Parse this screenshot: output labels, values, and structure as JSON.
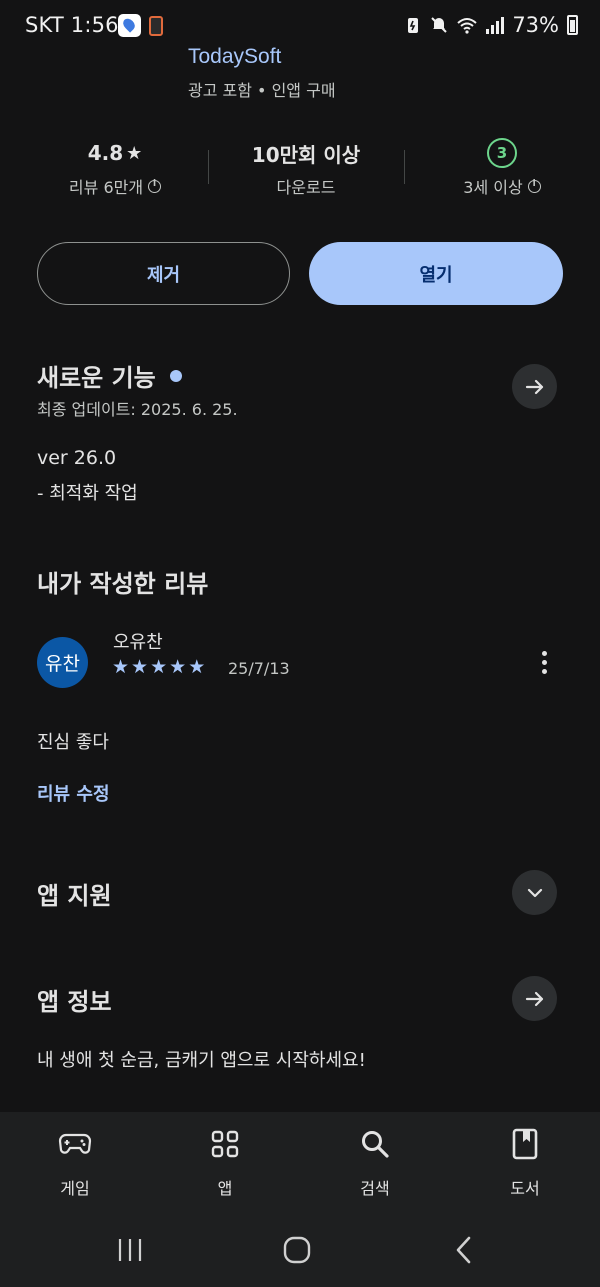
{
  "status_bar": {
    "carrier_time": "SKT 1:56",
    "battery": "73%"
  },
  "app": {
    "name": "TodaySoft",
    "subtitle": "광고 포함 • 인앱 구매"
  },
  "stats": {
    "rating": "4.8",
    "rating_label": "리뷰 6만개",
    "downloads": "10만회 이상",
    "downloads_label": "다운로드",
    "age_badge": "3",
    "age_label": "3세 이상"
  },
  "buttons": {
    "remove": "제거",
    "open": "열기"
  },
  "whats_new": {
    "title": "새로운 기능",
    "updated": "최종 업데이트: 2025. 6. 25.",
    "version": "ver 26.0",
    "notes": "- 최적화 작업"
  },
  "my_review": {
    "title": "내가 작성한 리뷰",
    "avatar_text": "유찬",
    "reviewer": "오유찬",
    "stars": 5,
    "date": "25/7/13",
    "text": "진심 좋다",
    "edit_link": "리뷰 수정"
  },
  "app_support": {
    "title": "앱 지원"
  },
  "app_info": {
    "title": "앱 정보",
    "description": "내 생애 첫 순금, 금캐기 앱으로 시작하세요!"
  },
  "bottom_nav": {
    "items": [
      {
        "label": "게임",
        "icon": "gamepad-icon"
      },
      {
        "label": "앱",
        "icon": "apps-grid-icon"
      },
      {
        "label": "검색",
        "icon": "search-icon"
      },
      {
        "label": "도서",
        "icon": "book-icon"
      }
    ]
  },
  "colors": {
    "background": "#131314",
    "accent": "#a8c7fa",
    "open_button_text": "#062e6f",
    "age_green": "#6dd58c",
    "avatar_bg": "#0b57a5"
  }
}
